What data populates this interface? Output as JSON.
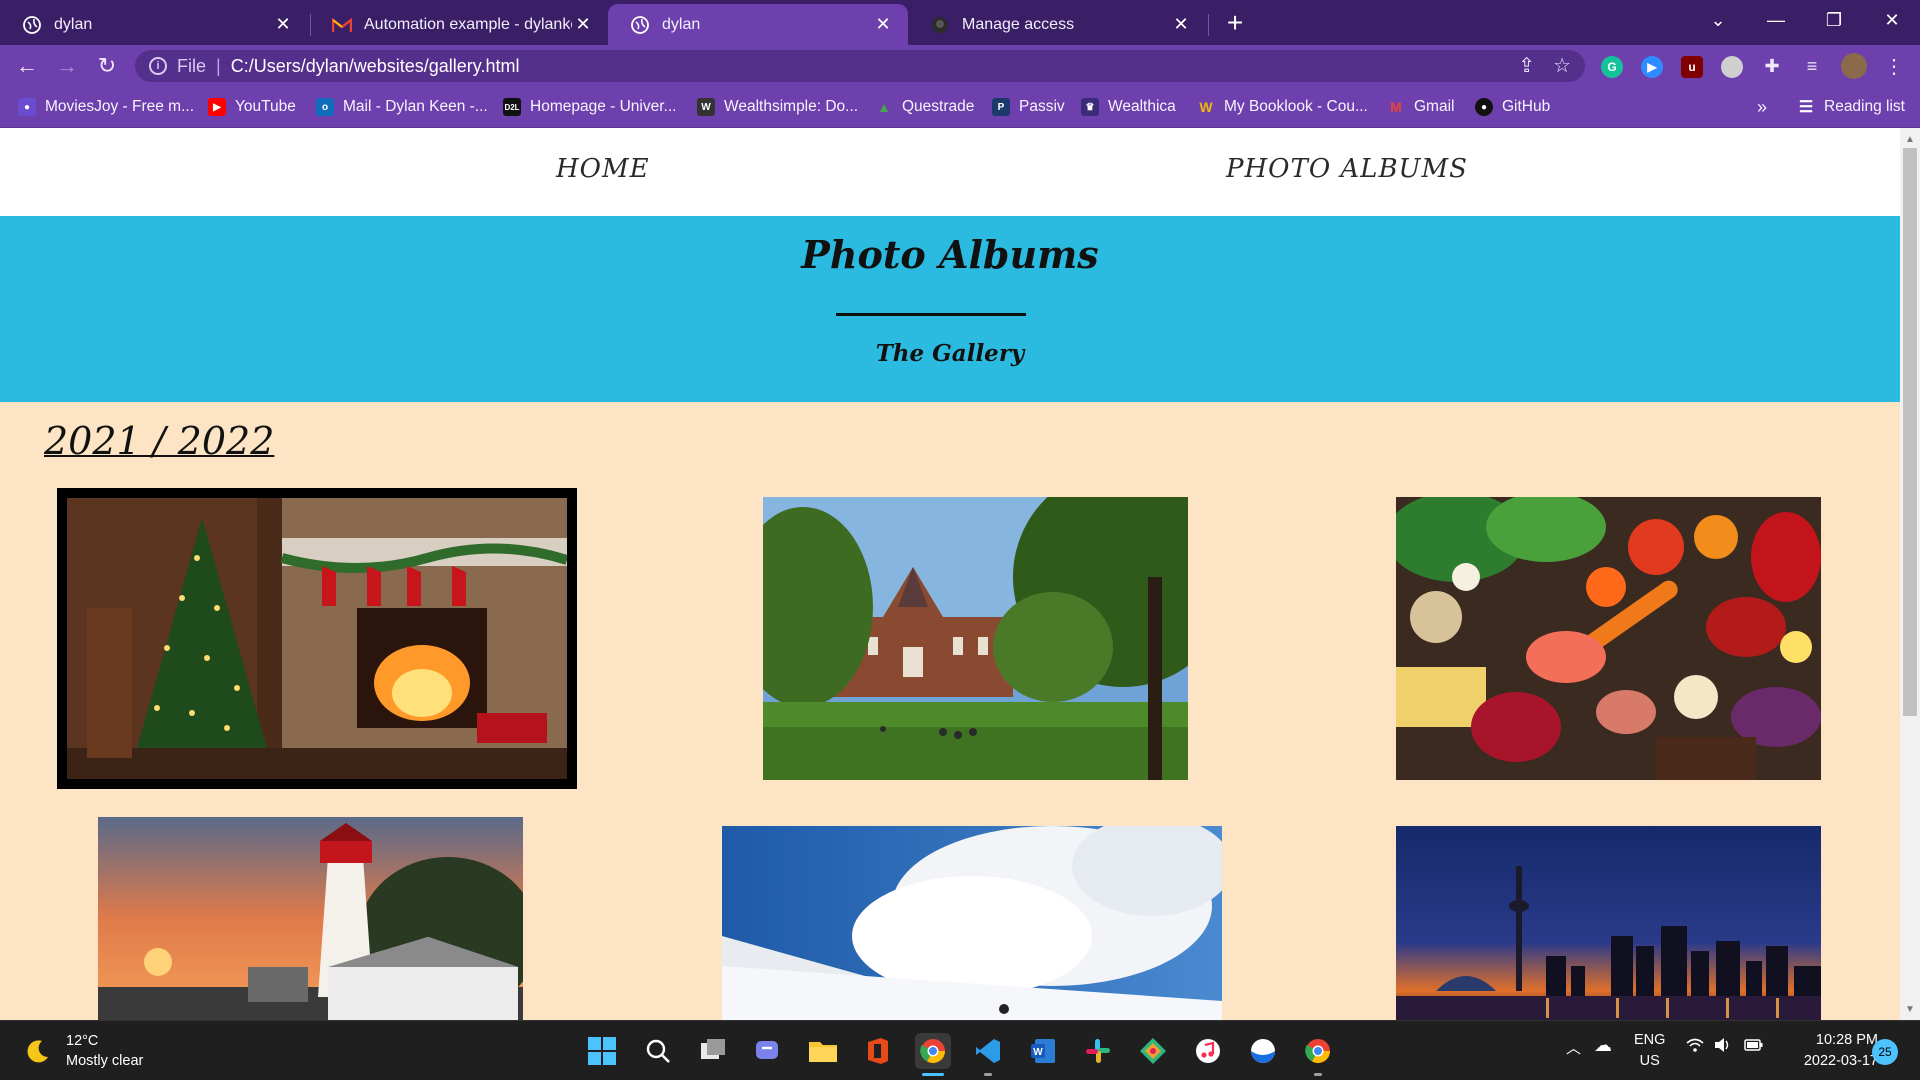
{
  "browser": {
    "tabs": [
      {
        "title": "dylan",
        "icon": "globe-icon",
        "active": false
      },
      {
        "title": "Automation example - dylankeen",
        "icon": "gmail-icon",
        "active": false
      },
      {
        "title": "dylan",
        "icon": "globe-icon",
        "active": true
      },
      {
        "title": "Manage access",
        "icon": "github-icon",
        "active": false
      }
    ],
    "address": {
      "scheme": "File",
      "url": "C:/Users/dylan/websites/gallery.html"
    },
    "bookmarks": [
      {
        "label": "MoviesJoy - Free m...",
        "icon": "moviesjoy-icon",
        "color": "#6b4bd0"
      },
      {
        "label": "YouTube",
        "icon": "youtube-icon",
        "color": "#ff0000"
      },
      {
        "label": "Mail - Dylan Keen -...",
        "icon": "outlook-icon",
        "color": "#0f6cbd"
      },
      {
        "label": "Homepage - Univer...",
        "icon": "d2l-icon",
        "color": "#111111"
      },
      {
        "label": "Wealthsimple: Do...",
        "icon": "wealthsimple-icon",
        "color": "#333333"
      },
      {
        "label": "Questrade",
        "icon": "questrade-icon",
        "color": "#4aa34a"
      },
      {
        "label": "Passiv",
        "icon": "passiv-icon",
        "color": "#1b3a6b"
      },
      {
        "label": "Wealthica",
        "icon": "wealthica-icon",
        "color": "#3c2a7a"
      },
      {
        "label": "My Booklook - Cou...",
        "icon": "booklook-icon",
        "color": "#f0b800"
      },
      {
        "label": "Gmail",
        "icon": "gmail-icon",
        "color": "#ea4335"
      },
      {
        "label": "GitHub",
        "icon": "github-icon",
        "color": "#111111"
      }
    ],
    "bookmarks_overflow": "»",
    "reading_list": "Reading list"
  },
  "page": {
    "nav": {
      "home": "HOME",
      "albums": "PHOTO ALBUMS"
    },
    "hero": {
      "title": "Photo Albums",
      "subtitle": "The Gallery"
    },
    "year_heading": "2021 / 2022",
    "photos": [
      "christmas-fireplace",
      "university-building",
      "fresh-produce",
      "lighthouse-sunset",
      "ski-slope-clouds",
      "toronto-skyline"
    ]
  },
  "taskbar": {
    "weather": {
      "temp": "12°C",
      "condition": "Mostly clear"
    },
    "language": {
      "lang": "ENG",
      "region": "US"
    },
    "clock": {
      "time": "10:28 PM",
      "date": "2022-03-17"
    },
    "notifications": "25"
  }
}
